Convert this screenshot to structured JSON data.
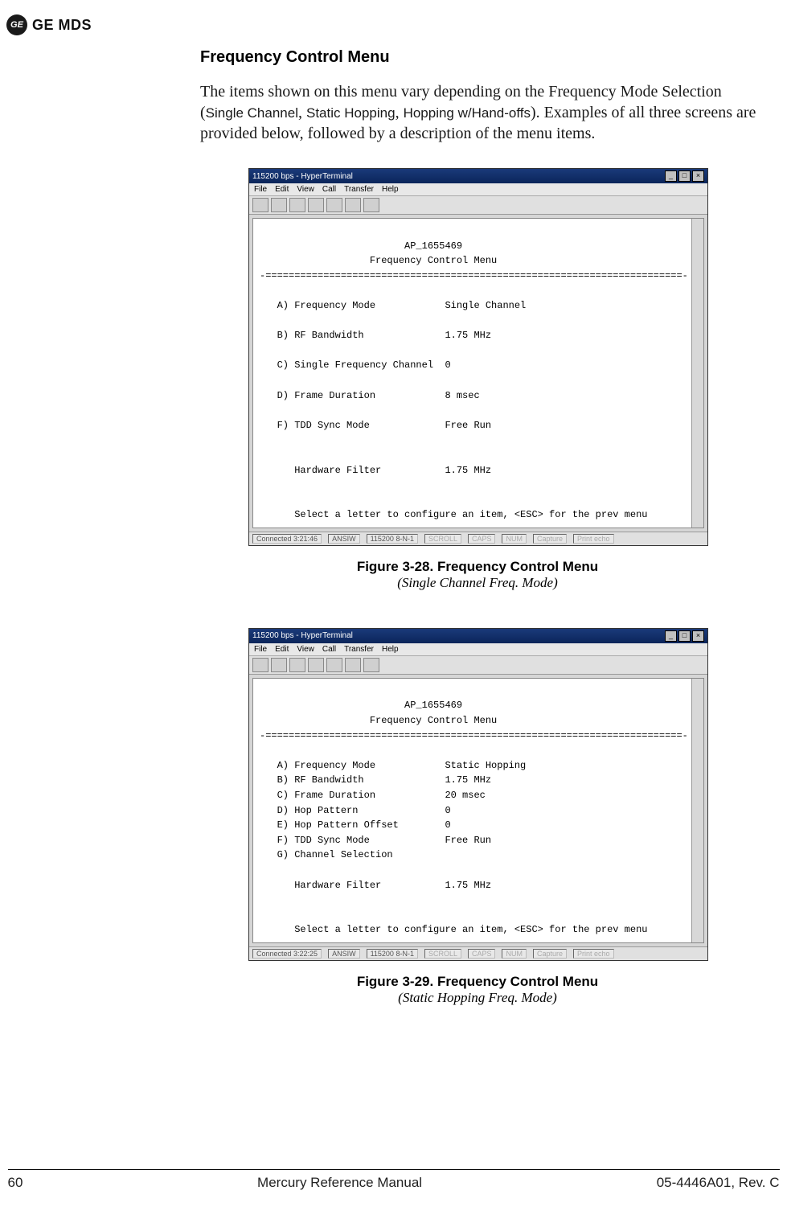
{
  "header": {
    "logo_text": "GE MDS",
    "ge_badge": "GE"
  },
  "section": {
    "heading": "Frequency Control Menu"
  },
  "paragraph": {
    "lead": "The items shown on this menu vary depending on the Frequency Mode Selection (",
    "mode1": "Single Channel",
    "sep1": ", ",
    "mode2": "Static Hopping",
    "sep2": ", ",
    "mode3": "Hopping w/Hand-offs",
    "tail": "). Examples of all three screens are provided below, followed by a description of the menu items."
  },
  "figure28": {
    "title": "Figure 3-28. Frequency Control Menu",
    "subtitle": "(Single Channel Freq. Mode)",
    "window_title": "115200 bps - HyperTerminal",
    "menus": [
      "File",
      "Edit",
      "View",
      "Call",
      "Transfer",
      "Help"
    ],
    "ap_name": "AP_1655469",
    "menu_title": "Frequency Control Menu",
    "items": [
      {
        "key": "A)",
        "label": "Frequency Mode",
        "value": "Single Channel"
      },
      {
        "key": "B)",
        "label": "RF Bandwidth",
        "value": "1.75 MHz"
      },
      {
        "key": "C)",
        "label": "Single Frequency Channel",
        "value": "0"
      },
      {
        "key": "D)",
        "label": "Frame Duration",
        "value": "8 msec"
      },
      {
        "key": "F)",
        "label": "TDD Sync Mode",
        "value": "Free Run"
      }
    ],
    "hw_filter_label": "Hardware Filter",
    "hw_filter_value": "1.75 MHz",
    "prompt": "Select a letter to configure an item, <ESC> for the prev menu",
    "status": {
      "conn": "Connected 3:21:46",
      "dev": "ANSIW",
      "baud": "115200 8-N-1",
      "f1": "SCROLL",
      "f2": "CAPS",
      "f3": "NUM",
      "f4": "Capture",
      "f5": "Print echo"
    }
  },
  "figure29": {
    "title": "Figure 3-29. Frequency Control Menu",
    "subtitle": "(Static Hopping Freq. Mode)",
    "window_title": "115200 bps - HyperTerminal",
    "menus": [
      "File",
      "Edit",
      "View",
      "Call",
      "Transfer",
      "Help"
    ],
    "ap_name": "AP_1655469",
    "menu_title": "Frequency Control Menu",
    "items": [
      {
        "key": "A)",
        "label": "Frequency Mode",
        "value": "Static Hopping"
      },
      {
        "key": "B)",
        "label": "RF Bandwidth",
        "value": "1.75 MHz"
      },
      {
        "key": "C)",
        "label": "Frame Duration",
        "value": "20 msec"
      },
      {
        "key": "D)",
        "label": "Hop Pattern",
        "value": "0"
      },
      {
        "key": "E)",
        "label": "Hop Pattern Offset",
        "value": "0"
      },
      {
        "key": "F)",
        "label": "TDD Sync Mode",
        "value": "Free Run"
      },
      {
        "key": "G)",
        "label": "Channel Selection",
        "value": ""
      }
    ],
    "hw_filter_label": "Hardware Filter",
    "hw_filter_value": "1.75 MHz",
    "prompt": "Select a letter to configure an item, <ESC> for the prev menu",
    "status": {
      "conn": "Connected 3:22:25",
      "dev": "ANSIW",
      "baud": "115200 8-N-1",
      "f1": "SCROLL",
      "f2": "CAPS",
      "f3": "NUM",
      "f4": "Capture",
      "f5": "Print echo"
    }
  },
  "footer": {
    "page_num": "60",
    "manual": "Mercury Reference Manual",
    "docnum": "05-4446A01, Rev. C"
  }
}
